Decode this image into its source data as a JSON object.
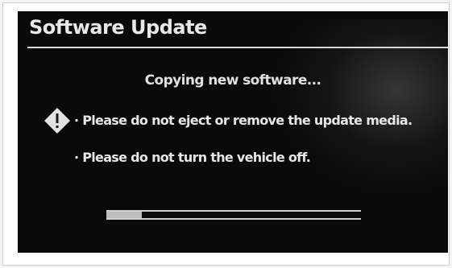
{
  "dialog": {
    "title": "Software Update",
    "status_text": "Copying new software...",
    "warnings": [
      "· Please do not eject or remove the update media.",
      "· Please do not turn the vehicle off."
    ],
    "warning_icon": "warning-diamond-icon",
    "progress_fraction": 0.14
  },
  "colors": {
    "background": "#0a0a0a",
    "text": "#e6e6e6",
    "frame": "#ffffff"
  }
}
